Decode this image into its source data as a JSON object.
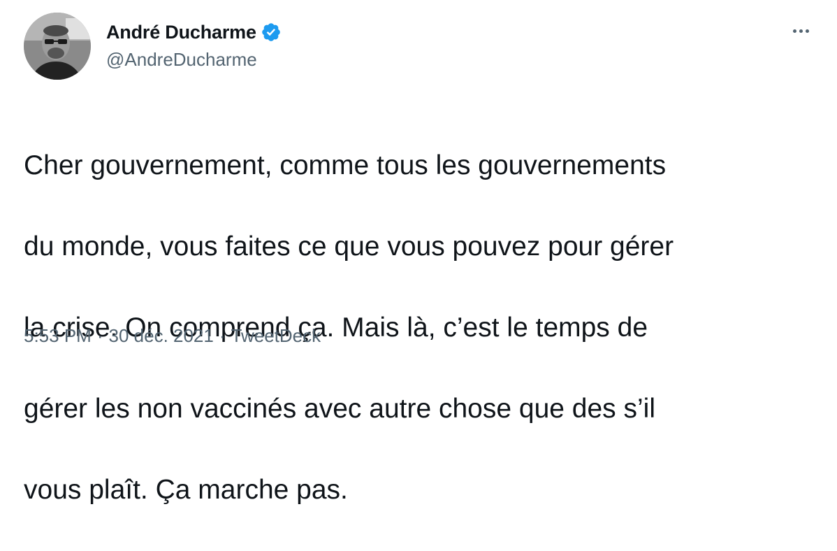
{
  "author": {
    "display_name": "André Ducharme",
    "handle": "@AndreDucharme",
    "verified": true
  },
  "tweet": {
    "lines": [
      "Cher gouvernement, comme tous les gouvernements",
      "du monde, vous faites ce que vous pouvez pour gérer",
      "la crise. On comprend ça. Mais là, c’est le temps de",
      "gérer les non vaccinés avec autre chose que des s’il",
      "vous plaît. Ça marche pas."
    ]
  },
  "meta": {
    "time": "5:53 PM",
    "separator": "·",
    "date": "30 déc. 2021",
    "source": "TweetDeck"
  },
  "icons": {
    "verified": "verified-badge-icon",
    "more": "more-horizontal-icon"
  },
  "colors": {
    "text": "#0f1419",
    "secondary": "#536471",
    "verified": "#1d9bf0",
    "background": "#ffffff"
  }
}
